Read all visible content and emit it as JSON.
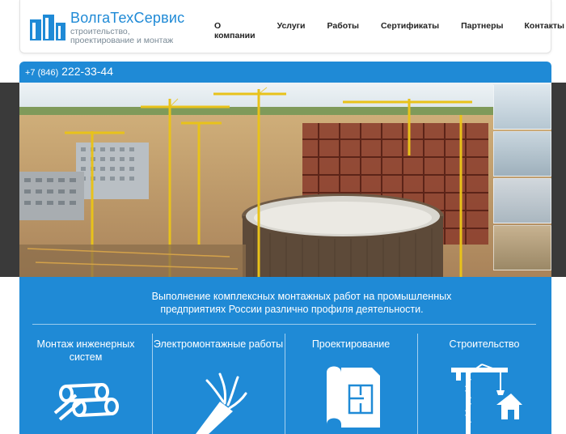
{
  "header": {
    "brand_name": "ВолгаТехСервис",
    "brand_tagline": "строительство, проектирование и монтаж",
    "nav": [
      {
        "label": "О компании"
      },
      {
        "label": "Услуги"
      },
      {
        "label": "Работы"
      },
      {
        "label": "Сертификаты"
      },
      {
        "label": "Партнеры"
      },
      {
        "label": "Контакты"
      }
    ]
  },
  "contact": {
    "phone_code": "+7 (846)",
    "phone_number": "222-33-44"
  },
  "hero": {
    "thumbnail_count": 4
  },
  "intro": {
    "line1": "Выполнение комплексных монтажных работ на промышленных",
    "line2": "предприятиях России различно профиля деятельности."
  },
  "services": [
    {
      "title": "Монтаж инженерных систем",
      "icon": "pipes-icon"
    },
    {
      "title": "Электромонтажные работы",
      "icon": "cable-icon"
    },
    {
      "title": "Проектирование",
      "icon": "blueprint-icon"
    },
    {
      "title": "Строительство",
      "icon": "crane-house-icon"
    }
  ],
  "colors": {
    "accent": "#1f8ad6",
    "dark_side": "#3a3a3a",
    "text": "#222222"
  }
}
